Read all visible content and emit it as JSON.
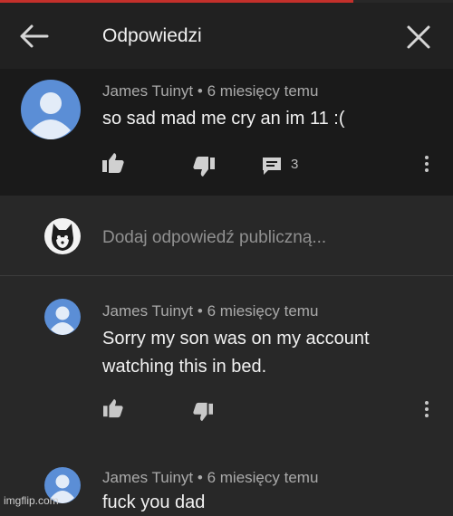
{
  "header": {
    "title": "Odpowiedzi",
    "back_icon": "arrow-left-icon",
    "close_icon": "close-icon"
  },
  "main_comment": {
    "author": "James Tuinyt",
    "separator": "•",
    "time": "6 miesięcy temu",
    "text": "so sad mad me cry an im 11 :(",
    "reply_count": "3"
  },
  "add_reply": {
    "placeholder": "Dodaj odpowiedź publiczną..."
  },
  "replies": [
    {
      "author": "James Tuinyt",
      "separator": "•",
      "time": "6 miesięcy temu",
      "text_line1": "Sorry my son was on my account",
      "text_line2": "watching this in bed."
    },
    {
      "author": "James Tuinyt",
      "separator": "•",
      "time": "6 miesięcy temu",
      "text_line1": "fuck you dad"
    }
  ],
  "watermark": "imgflip.com",
  "colors": {
    "background": "#282828",
    "header": "#212121",
    "highlighted_comment": "#1a1a1a",
    "avatar_blue": "#5b8ed6",
    "accent_red": "#c4302b"
  }
}
